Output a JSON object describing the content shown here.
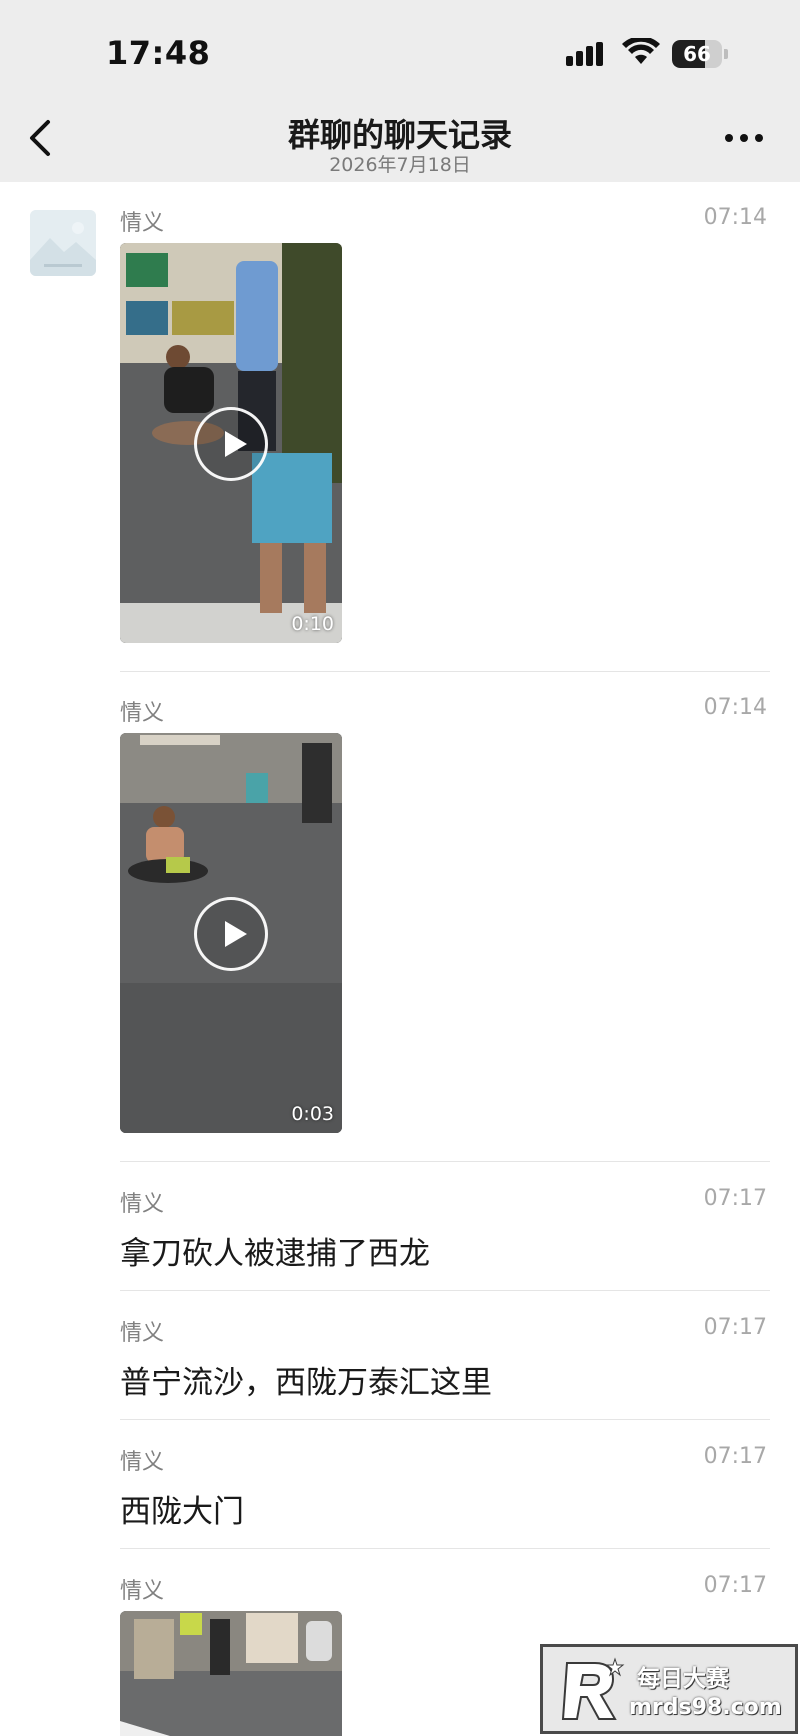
{
  "status_bar": {
    "time": "17:48",
    "battery": "66",
    "battery_level": 0.66
  },
  "header": {
    "title": "群聊的聊天记录",
    "subtitle": "2026年7月18日",
    "back_icon": "chevron-left-icon",
    "more_icon": "more-dots-icon"
  },
  "messages": [
    {
      "sender": "情义",
      "time": "07:14",
      "type": "video",
      "duration": "0:10"
    },
    {
      "sender": "情义",
      "time": "07:14",
      "type": "video",
      "duration": "0:03"
    },
    {
      "sender": "情义",
      "time": "07:17",
      "type": "text",
      "text": "拿刀砍人被逮捕了西龙"
    },
    {
      "sender": "情义",
      "time": "07:17",
      "type": "text",
      "text": "普宁流沙，西陇万泰汇这里"
    },
    {
      "sender": "情义",
      "time": "07:17",
      "type": "text",
      "text": "西陇大门"
    },
    {
      "sender": "情义",
      "time": "07:17",
      "type": "image"
    }
  ],
  "watermark": {
    "brand": "每日大赛",
    "url": "mrds98.com"
  },
  "colors": {
    "header_bg": "#ededed",
    "divider": "#e5e5e5",
    "timestamp": "#a8a8a8",
    "sender": "#808080"
  }
}
